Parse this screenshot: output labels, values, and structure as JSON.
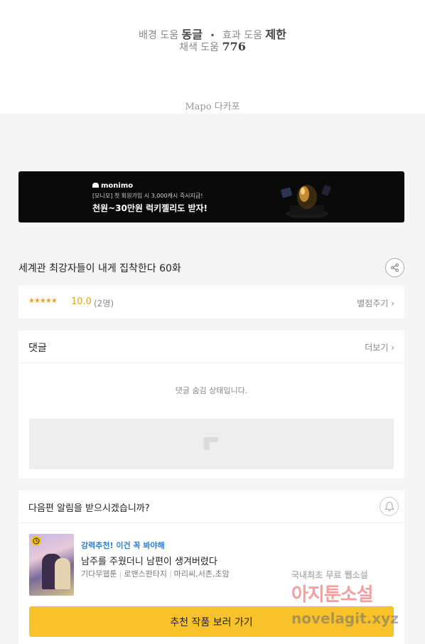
{
  "credits": {
    "top_cut_text": "",
    "bg_label": "배경 도움",
    "bg_value": "동글",
    "sep": "•",
    "fx_label": "효과 도움",
    "fx_value": "제한",
    "color_label": "채색 도움",
    "color_value": "776",
    "studio": "Mapo 다카포"
  },
  "ad": {
    "brand": "monimo",
    "line1": "[모니모] 첫 회원가입 시 3,000캐시 즉시지급!",
    "line2": "천원~30만원 럭키젤리도 받자!"
  },
  "episode": {
    "title": "세계관 최강자들이 내게 집착한다 60화"
  },
  "rating": {
    "stars": "★★★★★",
    "score": "10.0",
    "count": "(2명)",
    "rate_link": "별점주기"
  },
  "comments": {
    "label": "댓글",
    "more": "더보기",
    "hidden_msg": "댓글 숨김 상태입니다."
  },
  "notify": {
    "question": "다음편 알림을 받으시겠습니까?"
  },
  "recommend": {
    "tag": "강력추천! 이건 꼭 봐야해",
    "title": "남주를 주웠더니 남편이 생겨버렸다",
    "type": "기다무웹툰",
    "genre": "로맨스판타지",
    "authors": "마리씨,서촌,초암",
    "cta": "추천 작품 보러 가기"
  },
  "watermark": {
    "line1": "국내최초 무료 웹소설",
    "line2": "아지툰소설",
    "line3": "novelagit.xyz"
  }
}
